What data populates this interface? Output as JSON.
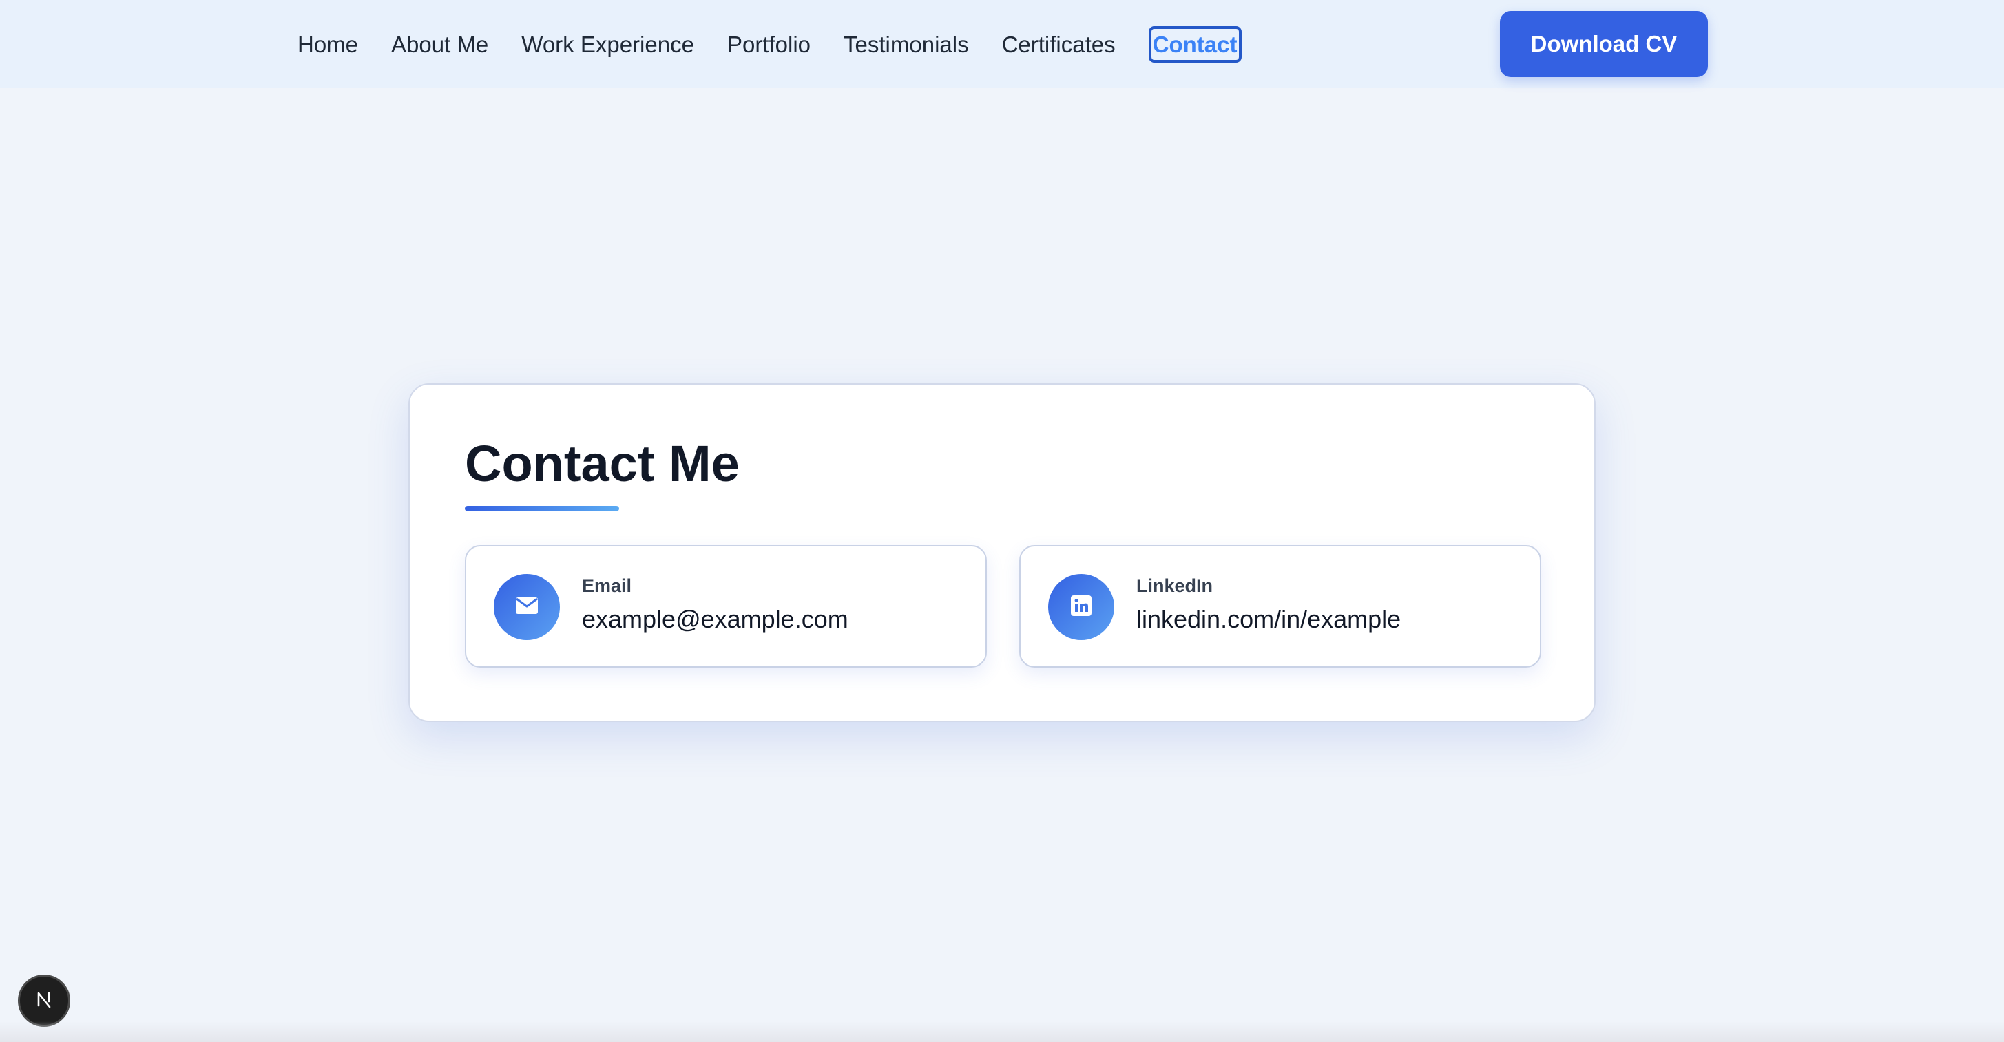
{
  "nav": {
    "items": [
      {
        "label": "Home",
        "active": false
      },
      {
        "label": "About Me",
        "active": false
      },
      {
        "label": "Work Experience",
        "active": false
      },
      {
        "label": "Portfolio",
        "active": false
      },
      {
        "label": "Testimonials",
        "active": false
      },
      {
        "label": "Certificates",
        "active": false
      },
      {
        "label": "Contact",
        "active": true
      }
    ],
    "download_label": "Download CV"
  },
  "contact": {
    "title": "Contact Me",
    "items": [
      {
        "label": "Email",
        "value": "example@example.com",
        "icon": "envelope-icon"
      },
      {
        "label": "LinkedIn",
        "value": "linkedin.com/in/example",
        "icon": "linkedin-icon"
      }
    ]
  },
  "badge": {
    "letter": "N",
    "icon": "nextjs-icon"
  },
  "colors": {
    "accent": "#3461e2",
    "accent_light": "#5aaaf2",
    "nav_background": "#e8f1fc",
    "page_background": "#f0f4fa",
    "active_link": "#3b82f6"
  }
}
